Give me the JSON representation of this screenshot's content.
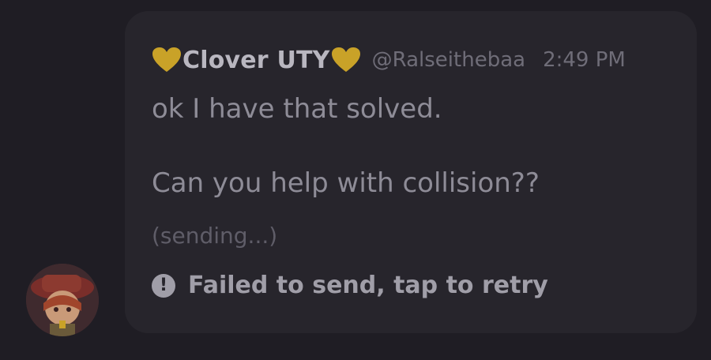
{
  "message": {
    "display_name": "Clover UTY",
    "username": "@Ralseithebaa",
    "timestamp": "2:49 PM",
    "lines": [
      "ok I have that solved.",
      "Can you help with collision??"
    ],
    "sending_status": "(sending...)",
    "failed_status": "Failed to send, tap to retry",
    "alert_glyph": "!"
  },
  "colors": {
    "heart": "#c9a228",
    "background": "#1f1d24",
    "bubble": "#27252c"
  },
  "icons": {
    "name_prefix": "yellow-heart-icon",
    "name_suffix": "yellow-heart-icon",
    "failed": "exclamation-circle-icon",
    "avatar": "user-avatar"
  }
}
